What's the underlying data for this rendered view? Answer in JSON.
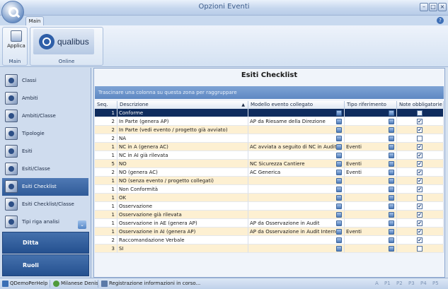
{
  "window": {
    "title": "Opzioni Eventi",
    "controls": {
      "minimize": "–",
      "maximize": "□",
      "close": "×"
    }
  },
  "ribbon": {
    "tab_label": "Main",
    "help": "?",
    "groups": [
      {
        "label": "Main",
        "button_label": "Applica"
      },
      {
        "label": "Online",
        "logo_text": "qualibus"
      }
    ]
  },
  "sidebar": {
    "items": [
      {
        "label": "Classi",
        "active": false
      },
      {
        "label": "Ambiti",
        "active": false
      },
      {
        "label": "Ambiti/Classe",
        "active": false
      },
      {
        "label": "Tipologie",
        "active": false
      },
      {
        "label": "Esiti",
        "active": false
      },
      {
        "label": "Esiti/Classe",
        "active": false
      },
      {
        "label": "Esiti Checklist",
        "active": true
      },
      {
        "label": "Esiti Checklist/Classe",
        "active": false
      },
      {
        "label": "Tipi riga analisi",
        "active": false
      }
    ],
    "scroll_glyph": "⌄",
    "sections": [
      {
        "label": "Ditta"
      },
      {
        "label": "Ruoli"
      }
    ]
  },
  "panel": {
    "title": "Esiti Checklist",
    "group_hint": "Trascinare una colonna su questa zona per raggruppare",
    "columns": {
      "seq": "Seq.",
      "descrizione": "Descrizione",
      "modello": "Modello evento collegato",
      "tipo": "Tipo riferimento",
      "note": "Note obbligatorie"
    },
    "sort_glyph": "▲",
    "rows": [
      {
        "seq": "1",
        "descrizione": "Conforme",
        "modello": "",
        "tipo": "",
        "note": false
      },
      {
        "seq": "2",
        "descrizione": "In Parte (genera AP)",
        "modello": "AP da Riesame della Direzione",
        "tipo": "",
        "note": true
      },
      {
        "seq": "2",
        "descrizione": "In Parte (vedi evento / progetto già avviato)",
        "modello": "",
        "tipo": "",
        "note": true
      },
      {
        "seq": "2",
        "descrizione": "NA",
        "modello": "",
        "tipo": "",
        "note": false
      },
      {
        "seq": "1",
        "descrizione": "NC in A (genera AC)",
        "modello": "AC avviata a seguito di NC in Audit",
        "tipo": "Eventi",
        "note": true
      },
      {
        "seq": "1",
        "descrizione": "NC in AI già rilevata",
        "modello": "",
        "tipo": "",
        "note": true
      },
      {
        "seq": "5",
        "descrizione": "NO",
        "modello": "NC Sicurezza Cantiere",
        "tipo": "Eventi",
        "note": true
      },
      {
        "seq": "2",
        "descrizione": "NO (genera AC)",
        "modello": "AC Generica",
        "tipo": "Eventi",
        "note": true
      },
      {
        "seq": "1",
        "descrizione": "NO (senza evento / progetto collegati)",
        "modello": "",
        "tipo": "",
        "note": true
      },
      {
        "seq": "1",
        "descrizione": "Non Conformità",
        "modello": "",
        "tipo": "",
        "note": true
      },
      {
        "seq": "1",
        "descrizione": "OK",
        "modello": "",
        "tipo": "",
        "note": false
      },
      {
        "seq": "1",
        "descrizione": "Osservazione",
        "modello": "",
        "tipo": "",
        "note": true
      },
      {
        "seq": "1",
        "descrizione": "Osservazione già rilevata",
        "modello": "",
        "tipo": "",
        "note": true
      },
      {
        "seq": "1",
        "descrizione": "Osservazione in AE (genera AP)",
        "modello": "AP da Osservazione in Audit",
        "tipo": "",
        "note": true
      },
      {
        "seq": "1",
        "descrizione": "Osservazione in AI (genera AP)",
        "modello": "AP da Osservazione in Audit Interno",
        "tipo": "Eventi",
        "note": true
      },
      {
        "seq": "2",
        "descrizione": "Raccomandazione Verbale",
        "modello": "",
        "tipo": "",
        "note": true
      },
      {
        "seq": "3",
        "descrizione": "SI",
        "modello": "",
        "tipo": "",
        "note": false
      }
    ]
  },
  "statusbar": {
    "db": "QDemoPerHelp",
    "user": "Milanese Denis",
    "message": "Registrazione informazioni in corso...",
    "keys": [
      "A",
      "P1",
      "P2",
      "P3",
      "P4",
      "P5"
    ]
  },
  "colors": {
    "accent": "#2f5a98",
    "selected_row": "#0f2c5e",
    "alt_row": "#fdf0d2"
  }
}
